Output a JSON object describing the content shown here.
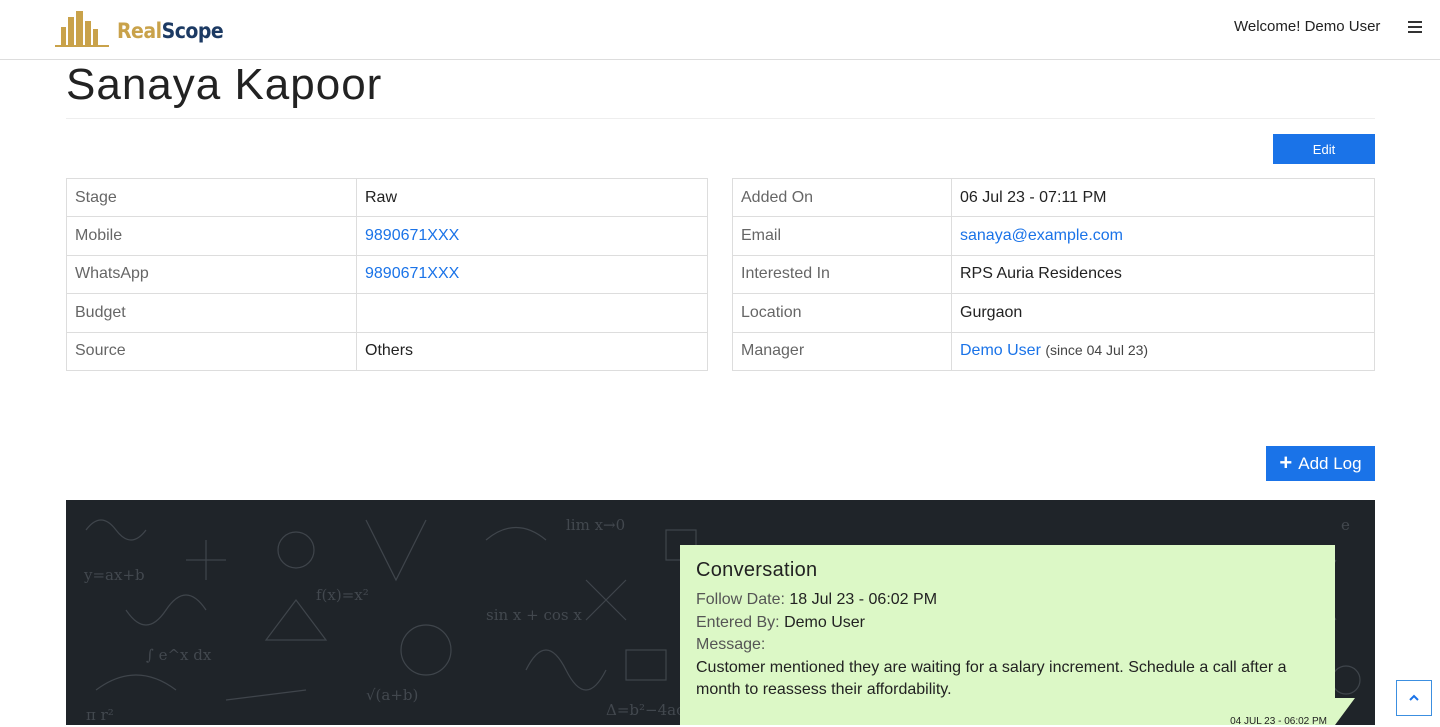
{
  "header": {
    "brand_part1": "Real",
    "brand_part2": "Scope",
    "welcome": "Welcome! Demo User",
    "menu_icon": "hamburger-menu-icon"
  },
  "page": {
    "title": "Sanaya Kapoor",
    "edit_label": "Edit",
    "add_log_label": "Add Log"
  },
  "left_table": [
    {
      "key": "Stage",
      "value": "Raw"
    },
    {
      "key": "Mobile",
      "value": "9890671XXX"
    },
    {
      "key": "WhatsApp",
      "value": "9890671XXX"
    },
    {
      "key": "Budget",
      "value": ""
    },
    {
      "key": "Source",
      "value": "Others"
    }
  ],
  "right_table": [
    {
      "key": "Added On",
      "value": "06 Jul 23 - 07:11 PM"
    },
    {
      "key": "Email",
      "value": "sanaya@example.com"
    },
    {
      "key": "Interested In",
      "value": "RPS Auria Residences"
    },
    {
      "key": "Location",
      "value": "Gurgaon"
    },
    {
      "key": "Manager",
      "value": "Demo User",
      "since": "(since 04 Jul 23)"
    }
  ],
  "log": {
    "title": "Conversation",
    "follow_label": "Follow Date:",
    "follow_value": "18 Jul 23 - 06:02 PM",
    "entered_label": "Entered By:",
    "entered_value": "Demo User",
    "message_label": "Message:",
    "message": "Customer mentioned they are waiting for a salary increment. Schedule a call after a month to reassess their affordability.",
    "stamp": "04 JUL 23 - 06:02 PM"
  },
  "colors": {
    "accent": "#1a73e8",
    "brand_gold": "#c9a24a",
    "brand_navy": "#1c3a63",
    "card_bg": "#dcf8c6",
    "board_bg": "#1f2429"
  }
}
